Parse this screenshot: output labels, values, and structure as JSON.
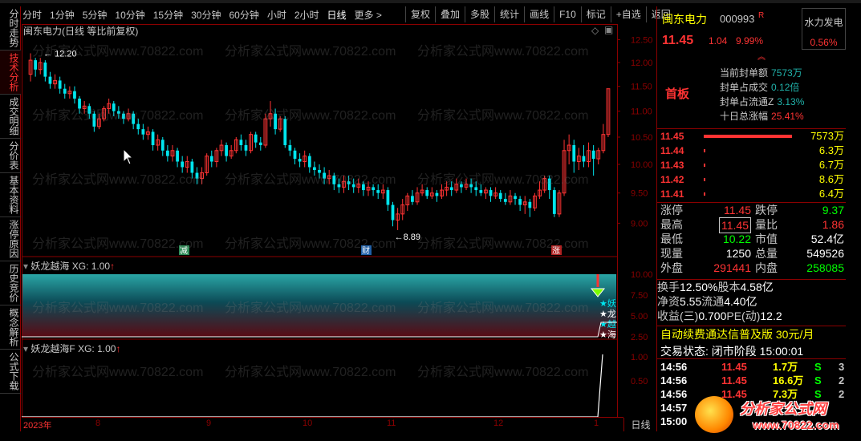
{
  "periods": [
    "分时",
    "1分钟",
    "5分钟",
    "10分钟",
    "15分钟",
    "30分钟",
    "60分钟",
    "小时",
    "2小时",
    "日线",
    "更多 >"
  ],
  "active_period": "日线",
  "toolbar": [
    "复权",
    "叠加",
    "多股",
    "统计",
    "画线",
    "F10",
    "标记",
    "+自选",
    "返回"
  ],
  "vtabs": [
    "分时走势",
    "技术分析",
    "成交明细",
    "分价表",
    "基本资料",
    "涨停原因",
    "历史竞价",
    "概念解析",
    "公式下载"
  ],
  "active_vtab": "技术分析",
  "chart_title": "闽东电力(日线 等比前复权)",
  "main_annot": {
    "high": "12.20",
    "low": "8.89",
    "mark_reduce": "减",
    "mark_fin": "财",
    "mark_up": "涨"
  },
  "ind1": {
    "name": "妖龙越海",
    "xg": "XG: 1.00",
    "arrow": "↑",
    "signal_text": [
      "★妖",
      "★龙",
      "★越",
      "★海"
    ]
  },
  "ind2": {
    "name": "妖龙越海F",
    "xg": "XG: 1.00",
    "arrow": "↑"
  },
  "xaxis": [
    "2023年",
    "8",
    "9",
    "10",
    "11",
    "12",
    "1"
  ],
  "day_label": "日线",
  "chart_data": {
    "type": "candlestick",
    "price_axis": [
      "12.50",
      "12.00",
      "11.50",
      "11.00",
      "10.50",
      "10.00",
      "9.50",
      "9.00"
    ],
    "ind1_axis": [
      "10.00",
      "7.50",
      "5.00",
      "2.50"
    ],
    "ind2_axis": [
      "1.00",
      "0.50"
    ],
    "ylim": [
      8.7,
      12.6
    ],
    "candles": [
      [
        11.75,
        12.05,
        12.2,
        11.6
      ],
      [
        12.05,
        11.85,
        12.1,
        11.7
      ],
      [
        11.85,
        12.0,
        12.1,
        11.75
      ],
      [
        12.0,
        11.7,
        12.05,
        11.6
      ],
      [
        11.7,
        11.55,
        11.8,
        11.45
      ],
      [
        11.55,
        11.62,
        11.75,
        11.45
      ],
      [
        11.62,
        11.45,
        11.7,
        11.35
      ],
      [
        11.45,
        11.35,
        11.55,
        11.25
      ],
      [
        11.35,
        11.4,
        11.5,
        11.25
      ],
      [
        11.4,
        11.25,
        11.5,
        11.15
      ],
      [
        11.25,
        11.05,
        11.3,
        10.95
      ],
      [
        11.05,
        11.1,
        11.2,
        10.95
      ],
      [
        11.1,
        10.95,
        11.15,
        10.85
      ],
      [
        10.95,
        10.7,
        11.0,
        10.6
      ],
      [
        10.7,
        10.85,
        10.95,
        10.65
      ],
      [
        10.85,
        11.05,
        11.1,
        10.8
      ],
      [
        11.05,
        11.15,
        11.25,
        10.95
      ],
      [
        11.15,
        11.0,
        11.2,
        10.9
      ],
      [
        11.0,
        10.95,
        11.1,
        10.85
      ],
      [
        10.95,
        10.85,
        11.0,
        10.75
      ],
      [
        10.85,
        10.95,
        11.05,
        10.8
      ],
      [
        10.95,
        10.75,
        11.0,
        10.65
      ],
      [
        10.75,
        10.65,
        10.85,
        10.55
      ],
      [
        10.65,
        10.55,
        10.75,
        10.45
      ],
      [
        10.55,
        10.6,
        10.7,
        10.45
      ],
      [
        10.6,
        10.35,
        10.65,
        10.25
      ],
      [
        10.35,
        10.45,
        10.55,
        10.25
      ],
      [
        10.45,
        10.25,
        10.5,
        10.15
      ],
      [
        10.25,
        10.15,
        10.35,
        10.05
      ],
      [
        10.15,
        10.25,
        10.35,
        10.05
      ],
      [
        10.25,
        10.05,
        10.3,
        9.95
      ],
      [
        10.05,
        9.95,
        10.15,
        9.85
      ],
      [
        9.95,
        10.05,
        10.15,
        9.85
      ],
      [
        10.05,
        9.85,
        10.1,
        9.75
      ],
      [
        9.85,
        9.75,
        9.95,
        9.65
      ],
      [
        9.75,
        9.85,
        9.95,
        9.65
      ],
      [
        9.85,
        10.15,
        10.2,
        9.8
      ],
      [
        10.15,
        10.05,
        10.25,
        9.95
      ],
      [
        10.05,
        10.25,
        10.3,
        9.95
      ],
      [
        10.25,
        10.35,
        10.45,
        10.15
      ],
      [
        10.35,
        10.15,
        10.4,
        10.05
      ],
      [
        10.15,
        10.25,
        10.35,
        10.1
      ],
      [
        10.25,
        10.45,
        10.5,
        10.2
      ],
      [
        10.45,
        10.35,
        10.55,
        10.25
      ],
      [
        10.35,
        10.25,
        10.45,
        10.15
      ],
      [
        10.25,
        10.55,
        10.6,
        10.2
      ],
      [
        10.55,
        10.4,
        10.6,
        10.3
      ],
      [
        10.4,
        10.35,
        10.5,
        10.25
      ],
      [
        10.35,
        10.85,
        10.95,
        10.3
      ],
      [
        10.85,
        10.95,
        11.2,
        10.7
      ],
      [
        10.95,
        10.65,
        11.05,
        10.55
      ],
      [
        10.65,
        10.85,
        10.9,
        10.6
      ],
      [
        10.85,
        10.35,
        10.9,
        10.3
      ],
      [
        10.35,
        10.25,
        10.45,
        10.15
      ],
      [
        10.25,
        10.1,
        10.3,
        10.0
      ],
      [
        10.1,
        10.05,
        10.2,
        9.95
      ],
      [
        10.05,
        10.15,
        10.25,
        9.95
      ],
      [
        10.15,
        9.95,
        10.2,
        9.85
      ],
      [
        9.95,
        9.9,
        10.05,
        9.8
      ],
      [
        9.9,
        9.85,
        10.0,
        9.75
      ],
      [
        9.85,
        9.75,
        9.95,
        9.65
      ],
      [
        9.75,
        9.8,
        9.9,
        9.65
      ],
      [
        9.8,
        9.65,
        9.85,
        9.55
      ],
      [
        9.65,
        9.6,
        9.75,
        9.5
      ],
      [
        9.6,
        9.7,
        9.8,
        9.5
      ],
      [
        9.7,
        9.65,
        9.8,
        9.55
      ],
      [
        9.65,
        9.6,
        9.75,
        9.5
      ],
      [
        9.6,
        9.65,
        9.75,
        9.5
      ],
      [
        9.65,
        9.55,
        9.7,
        9.45
      ],
      [
        9.55,
        9.6,
        9.7,
        9.45
      ],
      [
        9.6,
        9.55,
        9.65,
        9.45
      ],
      [
        9.55,
        9.5,
        9.65,
        9.4
      ],
      [
        9.5,
        9.55,
        9.65,
        9.4
      ],
      [
        9.55,
        9.3,
        9.6,
        9.2
      ],
      [
        9.3,
        9.05,
        9.35,
        8.95
      ],
      [
        9.05,
        9.15,
        9.25,
        8.89
      ],
      [
        9.15,
        9.3,
        9.4,
        9.05
      ],
      [
        9.3,
        9.45,
        9.5,
        9.2
      ],
      [
        9.45,
        9.35,
        9.55,
        9.3
      ],
      [
        9.35,
        9.5,
        9.6,
        9.3
      ],
      [
        9.5,
        9.55,
        9.65,
        9.45
      ],
      [
        9.55,
        9.45,
        9.6,
        9.4
      ],
      [
        9.45,
        9.5,
        9.6,
        9.4
      ],
      [
        9.5,
        9.45,
        9.55,
        9.35
      ],
      [
        9.45,
        9.55,
        9.65,
        9.4
      ],
      [
        9.55,
        9.6,
        9.7,
        9.45
      ],
      [
        9.6,
        9.55,
        9.7,
        9.45
      ],
      [
        9.55,
        9.65,
        9.75,
        9.5
      ],
      [
        9.65,
        9.6,
        9.7,
        9.5
      ],
      [
        9.6,
        9.65,
        9.75,
        9.55
      ],
      [
        9.65,
        9.6,
        9.75,
        9.5
      ],
      [
        9.6,
        9.55,
        9.7,
        9.45
      ],
      [
        9.55,
        9.5,
        9.65,
        9.45
      ],
      [
        9.5,
        9.55,
        9.6,
        9.4
      ],
      [
        9.55,
        9.45,
        9.6,
        9.35
      ],
      [
        9.45,
        9.5,
        9.6,
        9.4
      ],
      [
        9.5,
        9.4,
        9.55,
        9.35
      ],
      [
        9.4,
        9.35,
        9.5,
        9.3
      ],
      [
        9.35,
        9.45,
        9.55,
        9.3
      ],
      [
        9.45,
        9.4,
        9.5,
        9.3
      ],
      [
        9.4,
        9.3,
        9.45,
        9.2
      ],
      [
        9.3,
        9.35,
        9.45,
        9.15
      ],
      [
        9.35,
        9.25,
        9.4,
        9.1
      ],
      [
        9.25,
        9.45,
        9.5,
        9.2
      ],
      [
        9.45,
        9.55,
        9.7,
        9.4
      ],
      [
        9.55,
        9.75,
        9.8,
        9.5
      ],
      [
        9.75,
        9.55,
        9.8,
        9.4
      ],
      [
        9.55,
        9.15,
        9.6,
        9.1
      ],
      [
        9.15,
        9.5,
        9.55,
        9.1
      ],
      [
        9.5,
        10.25,
        10.45,
        9.45
      ],
      [
        10.25,
        10.35,
        10.55,
        10.0
      ],
      [
        10.35,
        10.05,
        10.45,
        9.85
      ],
      [
        10.05,
        10.15,
        10.3,
        9.9
      ],
      [
        10.15,
        10.05,
        10.35,
        9.95
      ],
      [
        10.05,
        10.25,
        10.4,
        9.95
      ],
      [
        10.25,
        10.1,
        10.35,
        9.8
      ],
      [
        10.1,
        10.25,
        10.3,
        10.0
      ],
      [
        10.25,
        10.55,
        10.75,
        10.2
      ],
      [
        10.55,
        11.45,
        11.45,
        10.5
      ]
    ]
  },
  "right": {
    "name": "闽东电力",
    "code": "000993",
    "r_mark": "R",
    "price": "11.45",
    "change": "1.04",
    "pct": "9.99%",
    "sector_name": "水力发电",
    "sector_pct": "0.56%",
    "board": "首板",
    "seal": [
      {
        "k": "当前封单额",
        "v": "7573万"
      },
      {
        "k": "封单占成交",
        "v": "0.12倍"
      },
      {
        "k": "封单占流通Z",
        "v": "3.13%"
      },
      {
        "k": "十日总涨幅",
        "v": "25.41%",
        "red": true
      }
    ],
    "book": [
      {
        "p": "11.45",
        "v": "7573万",
        "w": 110
      },
      {
        "p": "11.44",
        "v": "6.3万",
        "w": 2
      },
      {
        "p": "11.43",
        "v": "6.7万",
        "w": 2
      },
      {
        "p": "11.42",
        "v": "8.6万",
        "w": 2
      },
      {
        "p": "11.41",
        "v": "6.4万",
        "w": 2
      }
    ],
    "stats": [
      {
        "k1": "涨停",
        "v1": "11.45",
        "c1": "red",
        "k2": "跌停",
        "v2": "9.37",
        "c2": "green"
      },
      {
        "k1": "最高",
        "v1": "11.45",
        "c1": "red",
        "k2": "量比",
        "v2": "1.86",
        "c2": "red",
        "box": true
      },
      {
        "k1": "最低",
        "v1": "10.22",
        "c1": "green",
        "k2": "市值",
        "v2": "52.4亿",
        "c2": "white"
      },
      {
        "k1": "现量",
        "v1": "1250",
        "c1": "white",
        "k2": "总量",
        "v2": "549526",
        "c2": "white"
      },
      {
        "k1": "外盘",
        "v1": "291441",
        "c1": "red",
        "k2": "内盘",
        "v2": "258085",
        "c2": "green"
      }
    ],
    "stats2": [
      {
        "k1": "换手",
        "v1": "12.50%",
        "c1": "white",
        "k2": "股本",
        "v2": "4.58亿",
        "c2": "white"
      },
      {
        "k1": "净资",
        "v1": "5.55",
        "c1": "white",
        "k2": "流通",
        "v2": "4.40亿",
        "c2": "white"
      },
      {
        "k1": "收益(三)",
        "v1": "0.700",
        "c1": "white",
        "k2": "PE(动)",
        "v2": "12.2",
        "c2": "white"
      }
    ],
    "ad": "自动续费通达信普及版  30元/月",
    "trade_status": "交易状态: 闭市阶段  15:00:01",
    "ticks": [
      {
        "t": "14:56",
        "p": "11.45",
        "v": "1.7万",
        "s": "S",
        "c": "3"
      },
      {
        "t": "14:56",
        "p": "11.45",
        "v": "16.6万",
        "s": "S",
        "c": "2"
      },
      {
        "t": "14:56",
        "p": "11.45",
        "v": "7.3万",
        "s": "S",
        "c": "2"
      },
      {
        "t": "14:57",
        "p": "",
        "v": "",
        "s": "",
        "c": ""
      },
      {
        "t": "15:00",
        "p": "",
        "v": "",
        "s": "",
        "c": ""
      }
    ]
  },
  "logo": {
    "line1": "分析家公式网",
    "line2": "www.70822.com"
  },
  "watermark": "分析家公式网www.70822.com"
}
